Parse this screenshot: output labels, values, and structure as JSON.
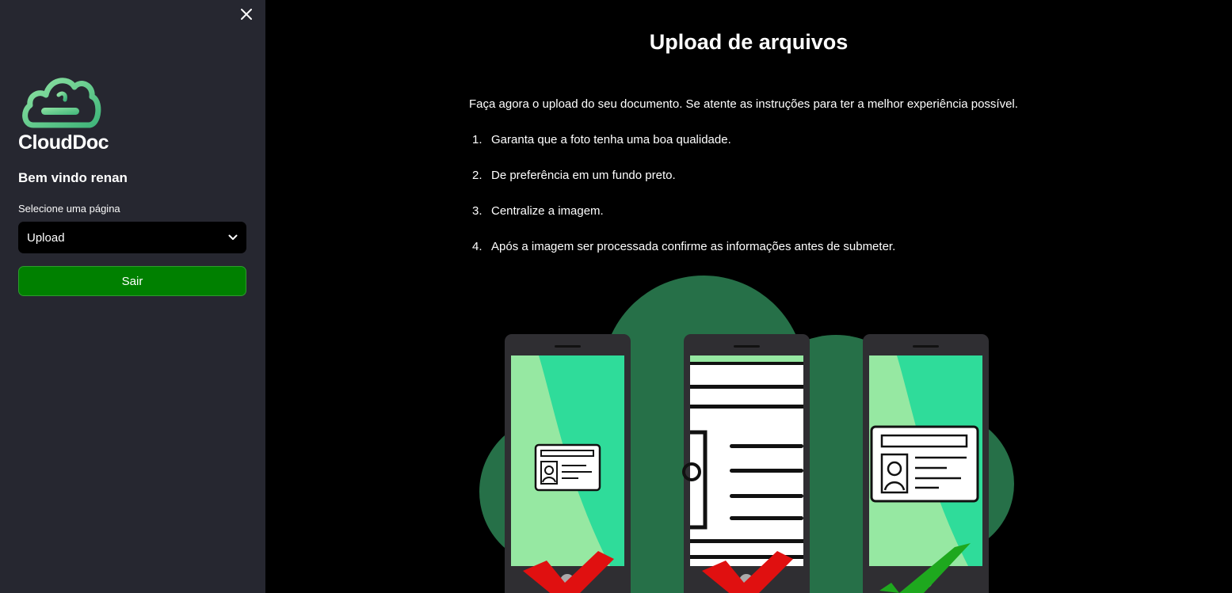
{
  "sidebar": {
    "logo_text": "CloudDoc",
    "welcome": "Bem vindo renan",
    "select_label": "Selecione uma página",
    "select_value": "Upload",
    "logout_label": "Sair"
  },
  "main": {
    "title": "Upload de arquivos",
    "intro": "Faça agora o upload do seu documento. Se atente as instruções para ter a melhor experiência possível.",
    "steps": [
      {
        "num": "1.",
        "text": "Garanta que a foto tenha uma boa qualidade."
      },
      {
        "num": "2.",
        "text": "De preferência em um fundo preto."
      },
      {
        "num": "3.",
        "text": "Centralize a imagem."
      },
      {
        "num": "4.",
        "text": "Após a imagem ser processada confirme as informações antes de submeter."
      }
    ]
  },
  "colors": {
    "sidebar_bg": "#262730",
    "accent_green": "#008000",
    "logo_green": "#4cc38a",
    "illustration_dark_green": "#267048",
    "screen_green": "#2fdc9a",
    "screen_light_green": "#96e8a2",
    "cross_red": "#e01010",
    "check_green": "#1ea81e"
  },
  "icons": {
    "close": "close-icon",
    "chevron": "chevron-down-icon",
    "logo": "cloud-logo-icon"
  }
}
